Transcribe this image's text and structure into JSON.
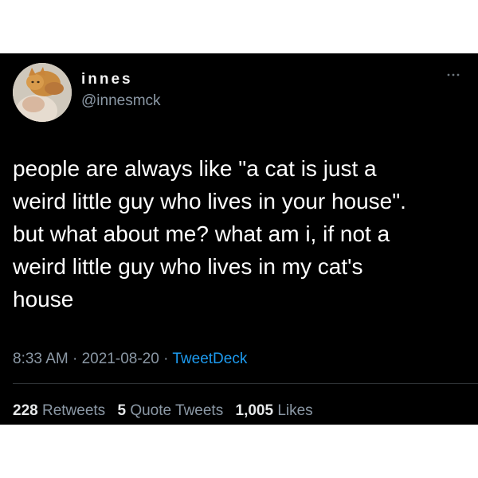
{
  "tweet": {
    "display_name": "innes",
    "handle": "@innesmck",
    "more_icon": "more-dots-icon",
    "text": "people are always like \"a cat is just a\nweird little guy who lives in your house\".\nbut what about me? what am i, if not a\nweird little guy who lives in my cat's\nhouse",
    "time": "8:33 AM",
    "date": "2021-08-20",
    "separator": "·",
    "source": "TweetDeck",
    "stats": {
      "retweets_count": "228",
      "retweets_label": "Retweets",
      "quote_count": "5",
      "quote_label": "Quote Tweets",
      "likes_count": "1,005",
      "likes_label": "Likes"
    }
  },
  "colors": {
    "background": "#000000",
    "text": "#ffffff",
    "secondary": "#8b98a5",
    "link": "#1d9bf0"
  }
}
